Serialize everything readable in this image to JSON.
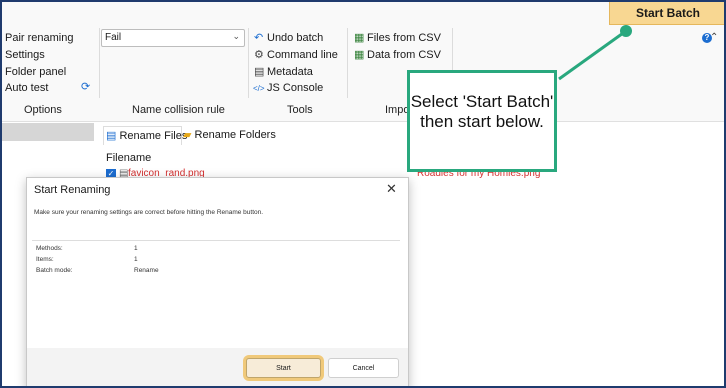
{
  "toolbar": {
    "start_batch_label": "Start Batch",
    "options": {
      "items": [
        "Pair renaming",
        "Settings",
        "Folder panel",
        "Auto test"
      ],
      "group_label": "Options"
    },
    "collision": {
      "value": "Fail",
      "group_label": "Name collision rule"
    },
    "tools": {
      "items": [
        "Undo batch",
        "Command line",
        "Metadata",
        "JS Console"
      ],
      "group_label": "Tools"
    },
    "import": {
      "items": [
        "Files from CSV",
        "Data from CSV"
      ],
      "group_label_partial": "Impo"
    }
  },
  "tabs": [
    {
      "label": "Rename Files"
    },
    {
      "label": "Rename Folders"
    }
  ],
  "file_list": {
    "header": "Filename",
    "first_file_partial": "favicon_rand.png",
    "right_file_partial": "Roadies for my Homies.png"
  },
  "callout": {
    "text": "Select 'Start Batch' then start below."
  },
  "dialog": {
    "title": "Start Renaming",
    "message": "Make sure your renaming settings are correct before hitting the Rename button.",
    "rows": [
      {
        "key": "Methods:",
        "value": "1"
      },
      {
        "key": "Items:",
        "value": "1"
      },
      {
        "key": "Batch mode:",
        "value": "Rename"
      }
    ],
    "start_label": "Start",
    "cancel_label": "Cancel"
  },
  "colors": {
    "accent_button": "#f8d792",
    "callout_border": "#29a87e",
    "frame_border": "#1f3b6e"
  }
}
